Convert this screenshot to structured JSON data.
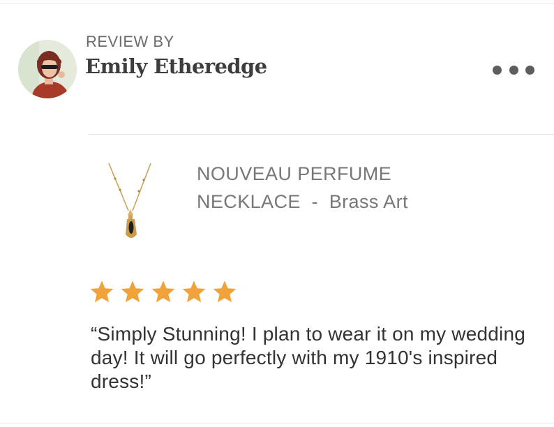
{
  "review": {
    "label": "REVIEW BY",
    "reviewer_name": "Emily Etheredge",
    "product_name_line1": "NOUVEAU PERFUME",
    "product_name_line2": "NECKLACE",
    "separator": "  -  ",
    "shop_name": "Brass Art",
    "rating": {
      "value": 5,
      "max": 5
    },
    "text": "“Simply Stunning! I plan to wear it on my wedding day! It will go perfectly with my 1910's inspired dress!”"
  },
  "icons": {
    "more": "more-horizontal-icon",
    "star": "star-icon"
  },
  "colors": {
    "star": "#f1a33b",
    "name": "#3d3d3d",
    "label": "#6b6b6b",
    "product": "#777777",
    "body": "#333333"
  }
}
